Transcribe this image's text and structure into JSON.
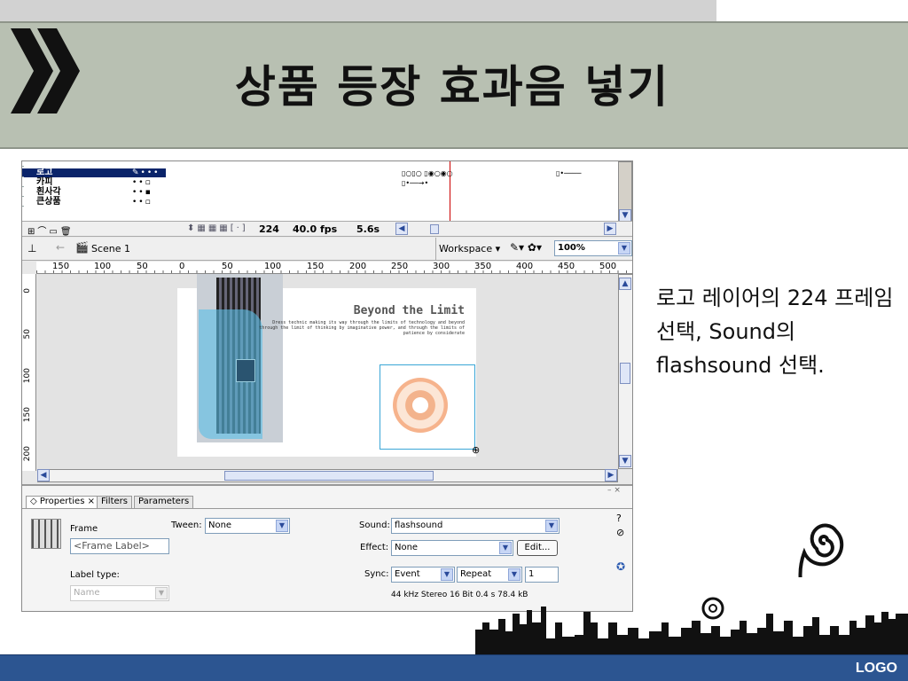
{
  "slide": {
    "title": "상품 등장 효과음 넣기",
    "description": "로고 레이어의 224 프레임 선택, Sound의 flashsound 선택.",
    "logo": "LOGO"
  },
  "timeline": {
    "layers": [
      "로고",
      "카피",
      "흰사각",
      "큰상품"
    ],
    "frame": "224",
    "fps": "40.0 fps",
    "time": "5.6s"
  },
  "stage": {
    "scene": "Scene 1",
    "workspace": "Workspace",
    "zoom": "100%",
    "ruler_top": [
      "150",
      "100",
      "50",
      "0",
      "50",
      "100",
      "150",
      "200",
      "250",
      "300",
      "350",
      "400",
      "450",
      "500"
    ],
    "ruler_left": [
      "0",
      "50",
      "100",
      "150",
      "200"
    ],
    "artwork_heading": "Beyond the Limit",
    "artwork_body": "Dress technic making its way through the limits of technology and beyond through the limit of thinking by imaginative power, and through the limits of patience by considerate"
  },
  "properties": {
    "tabs": [
      "Properties",
      "Filters",
      "Parameters"
    ],
    "frame_label": "Frame",
    "frame_label_placeholder": "<Frame Label>",
    "tween_label": "Tween:",
    "tween_value": "None",
    "label_type_label": "Label type:",
    "label_type_value": "Name",
    "sound_label": "Sound:",
    "sound_value": "flashsound",
    "effect_label": "Effect:",
    "effect_value": "None",
    "edit_button": "Edit...",
    "sync_label": "Sync:",
    "sync_value": "Event",
    "repeat_value": "Repeat",
    "repeat_count": "1",
    "sound_info": "44 kHz Stereo 16 Bit 0.4 s 78.4 kB"
  },
  "colors": {
    "title_bg": "#b8c0b2",
    "selection_blue": "#0a246a",
    "bottom_bar": "#2c5591",
    "playhead": "#cc0000"
  }
}
